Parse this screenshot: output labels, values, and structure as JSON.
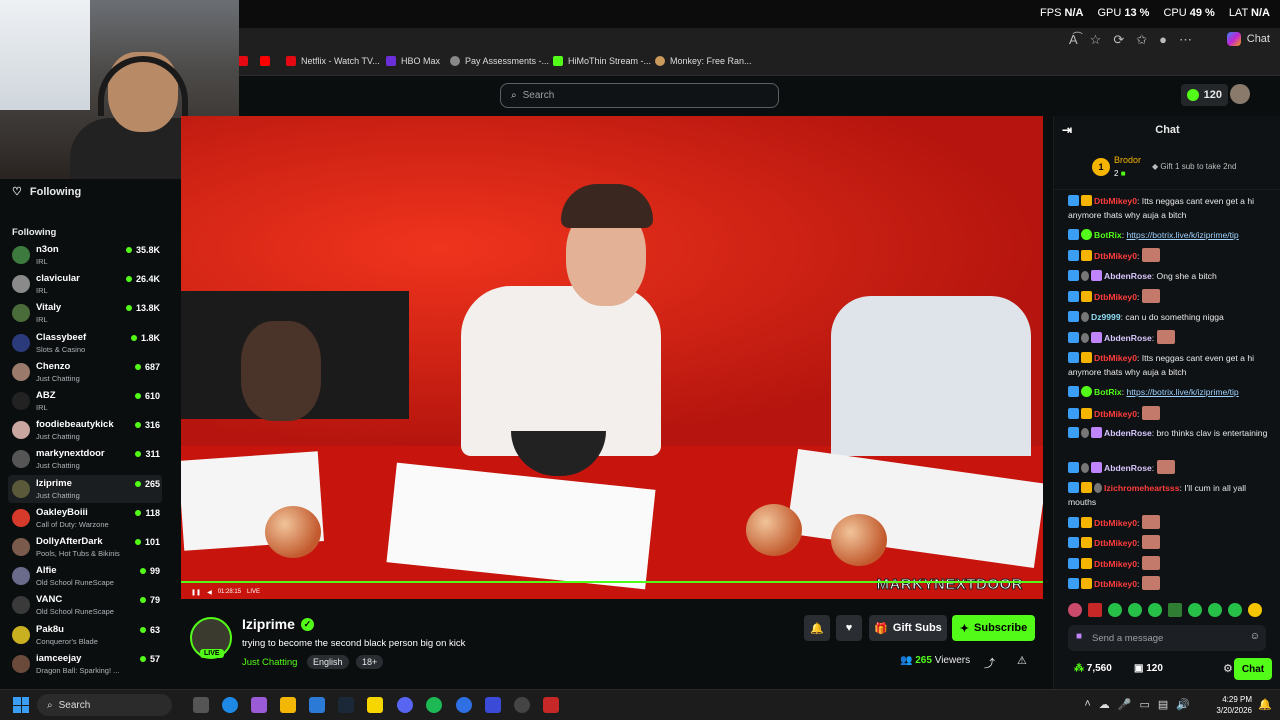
{
  "overlay": {
    "fps_label": "FPS",
    "fps_value": "N/A",
    "gpu_label": "GPU",
    "gpu_value": "13 %",
    "cpu_label": "CPU",
    "cpu_value": "49 %",
    "lat_label": "LAT",
    "lat_value": "N/A"
  },
  "browser": {
    "copilot_label": "Chat",
    "bookmarks": [
      {
        "label": "Netflix - Watch TV...",
        "color": "#e50914"
      },
      {
        "label": "HBO Max",
        "color": "#6b2fd9"
      },
      {
        "label": "Pay Assessments -...",
        "color": "#888888"
      },
      {
        "label": "HiMoThin Stream -...",
        "color": "#53fc18"
      },
      {
        "label": "Monkey: Free Ran...",
        "color": "#c99a5b"
      }
    ]
  },
  "topnav": {
    "search_placeholder": "Search",
    "points": "120"
  },
  "sidebar": {
    "header": "Following",
    "section": "Following",
    "channels": [
      {
        "name": "n3on",
        "category": "IRL",
        "viewers": "35.8K",
        "color": "#3d7a3d"
      },
      {
        "name": "clavicular",
        "category": "IRL",
        "viewers": "26.4K",
        "color": "#8a8a8a"
      },
      {
        "name": "Vitaly",
        "category": "IRL",
        "viewers": "13.8K",
        "color": "#4a6b3a"
      },
      {
        "name": "Classybeef",
        "category": "Slots & Casino",
        "viewers": "1.8K",
        "color": "#2a3a7a"
      },
      {
        "name": "Chenzo",
        "category": "Just Chatting",
        "viewers": "687",
        "color": "#9a7a6a"
      },
      {
        "name": "ABZ",
        "category": "IRL",
        "viewers": "610",
        "color": "#222222"
      },
      {
        "name": "foodiebeautykick",
        "category": "Just Chatting",
        "viewers": "316",
        "color": "#c9a6a0"
      },
      {
        "name": "markynextdoor",
        "category": "Just Chatting",
        "viewers": "311",
        "color": "#555555"
      },
      {
        "name": "Iziprime",
        "category": "Just Chatting",
        "viewers": "265",
        "color": "#5a5a3a",
        "active": true
      },
      {
        "name": "OakleyBoiii",
        "category": "Call of Duty: Warzone",
        "viewers": "118",
        "color": "#d63a2a"
      },
      {
        "name": "DollyAfterDark",
        "category": "Pools, Hot Tubs & Bikinis",
        "viewers": "101",
        "color": "#7a5a4a"
      },
      {
        "name": "Alfie",
        "category": "Old School RuneScape",
        "viewers": "99",
        "color": "#6a6a8a"
      },
      {
        "name": "VANC",
        "category": "Old School RuneScape",
        "viewers": "79",
        "color": "#3a3a3a"
      },
      {
        "name": "Pak8u",
        "category": "Conqueror's Blade",
        "viewers": "63",
        "color": "#c9b020"
      },
      {
        "name": "iamceejay",
        "category": "Dragon Ball: Sparking! ...",
        "viewers": "57",
        "color": "#6a4a3a"
      }
    ]
  },
  "video": {
    "watermark": "MARKYNEXTDOOR",
    "time": "01:28:15",
    "live_label": "LIVE",
    "progress": 1.0
  },
  "stream": {
    "live_badge": "LIVE",
    "name": "Iziprime",
    "title": "trying to become the second black person big on kick",
    "category": "Just Chatting",
    "tags": [
      "English",
      "18+"
    ],
    "gift_label": "Gift Subs",
    "subscribe_label": "Subscribe",
    "viewer_count": "265",
    "viewers_label": "Viewers"
  },
  "chat": {
    "title": "Chat",
    "pinned": {
      "rank": "1",
      "name": "Brodor",
      "count": "2",
      "gift_text": "Gift 1 sub to take 2nd"
    },
    "messages": [
      {
        "user": "DtbMikey0",
        "color": "red",
        "text": "Itts neggas cant even get a hi anymore thats why auja a bitch",
        "badges": [
          "blue",
          "gold"
        ]
      },
      {
        "user": "BotRix",
        "color": "green",
        "text": "https://botrix.live/k/iziprime/tip",
        "badges": [
          "blue",
          "green"
        ],
        "link": true
      },
      {
        "user": "DtbMikey0",
        "color": "red",
        "text": "",
        "badges": [
          "blue",
          "gold"
        ],
        "emote": true
      },
      {
        "user": "AbdenRose",
        "color": "lav",
        "text": "Ong she a bitch",
        "badges": [
          "blue",
          "grey",
          "purple"
        ]
      },
      {
        "user": "DtbMikey0",
        "color": "red",
        "text": "",
        "badges": [
          "blue",
          "gold"
        ],
        "emote": true
      },
      {
        "user": "Dz9999",
        "color": "cyan",
        "text": "can u do something nigga",
        "badges": [
          "blue",
          "grey"
        ]
      },
      {
        "user": "AbdenRose",
        "color": "lav",
        "text": "",
        "badges": [
          "blue",
          "grey",
          "purple"
        ],
        "emote": true
      },
      {
        "user": "DtbMikey0",
        "color": "red",
        "text": "Itts neggas cant even get a hi anymore thats why auja a bitch",
        "badges": [
          "blue",
          "gold"
        ]
      },
      {
        "user": "BotRix",
        "color": "green",
        "text": "https://botrix.live/k/iziprime/tip",
        "badges": [
          "blue",
          "green"
        ],
        "link": true
      },
      {
        "user": "DtbMikey0",
        "color": "red",
        "text": "",
        "badges": [
          "blue",
          "gold"
        ],
        "emote": true
      },
      {
        "user": "AbdenRose",
        "color": "lav",
        "text": "bro thinks clav is entertaining",
        "badges": [
          "blue",
          "grey",
          "purple"
        ]
      },
      {
        "user": "AbdenRose",
        "color": "lav",
        "text": "",
        "badges": [
          "blue",
          "grey",
          "purple"
        ],
        "emote": true
      },
      {
        "user": "Izichromeheartsss",
        "color": "red",
        "text": "I'll cum in all yall mouths",
        "badges": [
          "blue",
          "gold",
          "grey"
        ]
      },
      {
        "user": "DtbMikey0",
        "color": "red",
        "text": "",
        "badges": [
          "blue",
          "gold"
        ],
        "emote": true
      },
      {
        "user": "DtbMikey0",
        "color": "red",
        "text": "",
        "badges": [
          "blue",
          "gold"
        ],
        "emote": true
      },
      {
        "user": "DtbMikey0",
        "color": "red",
        "text": "",
        "badges": [
          "blue",
          "gold"
        ],
        "emote": true
      },
      {
        "user": "DtbMikey0",
        "color": "red",
        "text": "",
        "badges": [
          "blue",
          "gold"
        ],
        "emote": true
      }
    ],
    "input_placeholder": "Send a message",
    "points": "7,560",
    "count": "120",
    "send_label": "Chat"
  },
  "taskbar": {
    "search_label": "Search",
    "time": "4:29 PM",
    "date": "3/20/2026"
  }
}
